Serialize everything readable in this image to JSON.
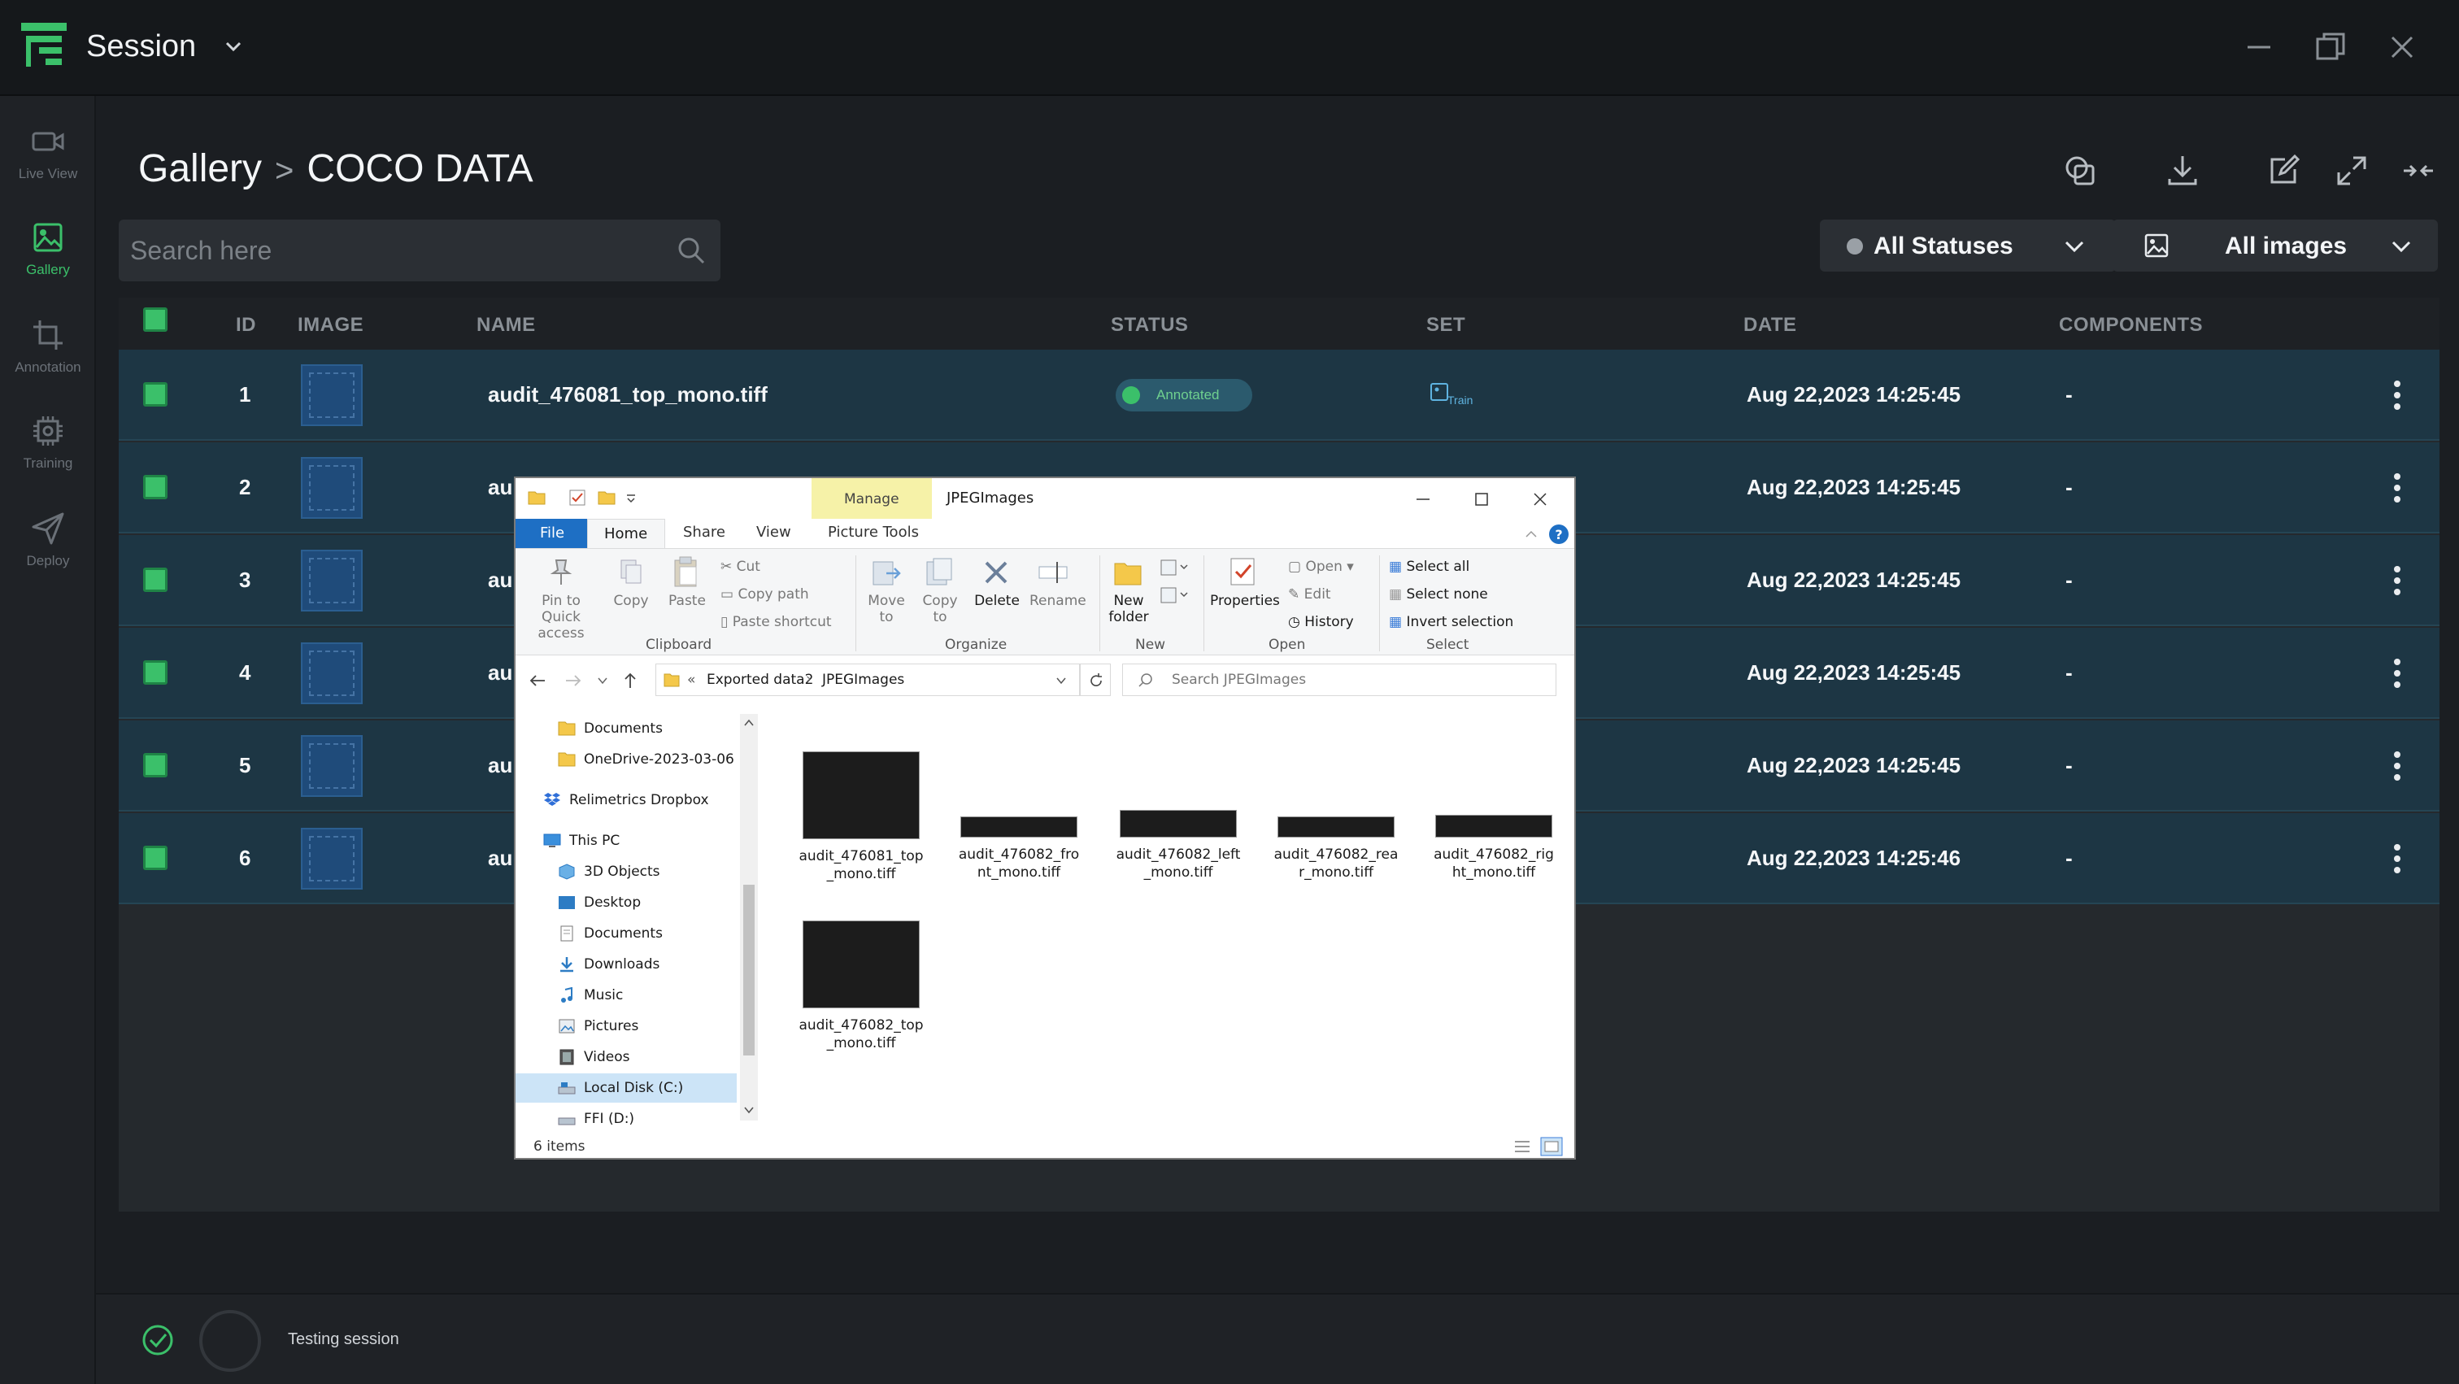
{
  "app": {
    "title": "Session"
  },
  "rail": {
    "items": [
      {
        "label": "Live View",
        "icon": "video-camera-icon"
      },
      {
        "label": "Gallery",
        "icon": "image-icon"
      },
      {
        "label": "Annotation",
        "icon": "crop-icon"
      },
      {
        "label": "Training",
        "icon": "chip-icon"
      },
      {
        "label": "Deploy",
        "icon": "send-icon"
      }
    ]
  },
  "header": {
    "breadcrumb": [
      "Gallery",
      "COCO DATA"
    ],
    "separator": ">"
  },
  "search": {
    "placeholder": "Search here"
  },
  "filters": {
    "status": "All Statuses",
    "images": "All images"
  },
  "table": {
    "columns": [
      "ID",
      "IMAGE",
      "NAME",
      "STATUS",
      "SET",
      "DATE",
      "COMPONENTS"
    ],
    "rows": [
      {
        "id": "1",
        "name": "audit_476081_top_mono.tiff",
        "status": "Annotated",
        "set": "Train",
        "date": "Aug 22,2023 14:25:45",
        "components": "-"
      },
      {
        "id": "2",
        "name": "au",
        "date": "Aug 22,2023 14:25:45",
        "components": "-"
      },
      {
        "id": "3",
        "name": "au",
        "date": "Aug 22,2023 14:25:45",
        "components": "-"
      },
      {
        "id": "4",
        "name": "au",
        "date": "Aug 22,2023 14:25:45",
        "components": "-"
      },
      {
        "id": "5",
        "name": "au",
        "date": "Aug 22,2023 14:25:45",
        "components": "-"
      },
      {
        "id": "6",
        "name": "au",
        "date": "Aug 22,2023 14:25:46",
        "components": "-"
      }
    ]
  },
  "statusbar": {
    "text": "Testing session"
  },
  "explorer": {
    "title": "JPEGImages",
    "context_tab": "Manage",
    "tabs": [
      "File",
      "Home",
      "Share",
      "View",
      "Picture Tools"
    ],
    "ribbon": {
      "clipboard": {
        "group": "Clipboard",
        "pin": [
          "Pin to Quick",
          "access"
        ],
        "copy": "Copy",
        "paste": "Paste",
        "cut": "Cut",
        "copy_path": "Copy path",
        "paste_shortcut": "Paste shortcut"
      },
      "organize": {
        "group": "Organize",
        "move": [
          "Move",
          "to"
        ],
        "copy_to": [
          "Copy",
          "to"
        ],
        "delete": "Delete",
        "rename": "Rename"
      },
      "new": {
        "group": "New",
        "folder": [
          "New",
          "folder"
        ]
      },
      "open": {
        "group": "Open",
        "properties": "Properties",
        "open": "Open",
        "edit": "Edit",
        "history": "History"
      },
      "select": {
        "group": "Select",
        "all": "Select all",
        "none": "Select none",
        "invert": "Invert selection"
      }
    },
    "address": {
      "prefix": "«",
      "path": [
        "Exported data2",
        "JPEGImages"
      ]
    },
    "search_placeholder": "Search JPEGImages",
    "nav": [
      "Documents",
      "OneDrive-2023-03-06",
      "Relimetrics Dropbox",
      "This PC",
      "3D Objects",
      "Desktop",
      "Documents",
      "Downloads",
      "Music",
      "Pictures",
      "Videos",
      "Local Disk (C:)",
      "FFI (D:)"
    ],
    "files": [
      {
        "name": [
          "audit_476081_top",
          "_mono.tiff"
        ]
      },
      {
        "name": [
          "audit_476082_fro",
          "nt_mono.tiff"
        ]
      },
      {
        "name": [
          "audit_476082_left",
          "_mono.tiff"
        ]
      },
      {
        "name": [
          "audit_476082_rea",
          "r_mono.tiff"
        ]
      },
      {
        "name": [
          "audit_476082_rig",
          "ht_mono.tiff"
        ]
      },
      {
        "name": [
          "audit_476082_top",
          "_mono.tiff"
        ]
      }
    ],
    "item_count": "6 items"
  },
  "colors": {
    "accent": "#3bc06a",
    "row_bg": "#1d3644",
    "app_bg": "#1b1e22"
  }
}
